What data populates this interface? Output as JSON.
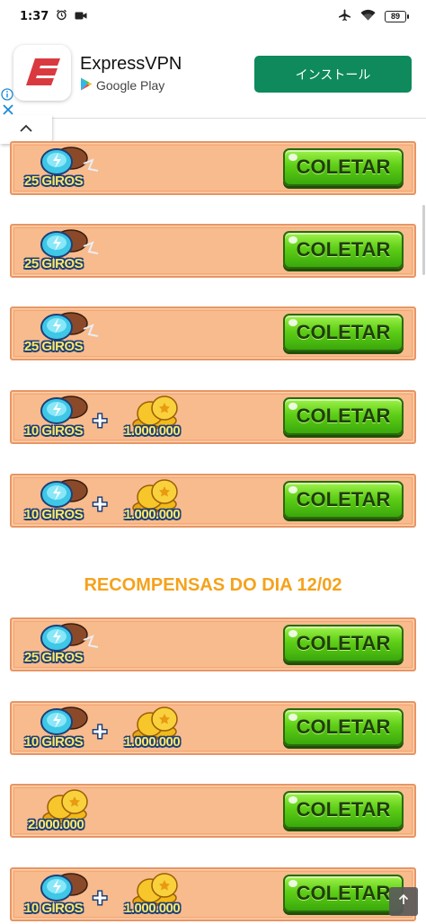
{
  "status_bar": {
    "time": "1:37",
    "battery": "89",
    "icons": [
      "alarm-icon",
      "video-record-icon",
      "airplane-mode-icon",
      "wifi-icon",
      "battery-icon"
    ]
  },
  "ad": {
    "app_name": "ExpressVPN",
    "store_name": "Google Play",
    "install_label": "インストール",
    "accent": "#0e8a5c",
    "logo_color": "#da3940"
  },
  "section_heading": "RECOMPENSAS DO DIA 12/02",
  "rewards": [
    {
      "type": "spins",
      "spins_label": "25 GIROS",
      "button_label": "COLETAR"
    },
    {
      "type": "spins",
      "spins_label": "25 GIROS",
      "button_label": "COLETAR"
    },
    {
      "type": "spins",
      "spins_label": "25 GIROS",
      "button_label": "COLETAR"
    },
    {
      "type": "spins_coins",
      "spins_label": "10 GIROS",
      "coins_label": "1.000.000",
      "button_label": "COLETAR"
    },
    {
      "type": "spins_coins",
      "spins_label": "10 GIROS",
      "coins_label": "1.000.000",
      "button_label": "COLETAR"
    },
    {
      "type": "spins",
      "spins_label": "25 GIROS",
      "button_label": "COLETAR"
    },
    {
      "type": "spins_coins",
      "spins_label": "10 GIROS",
      "coins_label": "1.000.000",
      "button_label": "COLETAR"
    },
    {
      "type": "coins",
      "coins_label": "2.000.000",
      "button_label": "COLETAR"
    },
    {
      "type": "spins_coins",
      "spins_label": "10 GIROS",
      "coins_label": "1.000.000",
      "button_label": "COLETAR"
    }
  ],
  "colors": {
    "row_fill": "#f8bb8d",
    "row_border": "#e89563",
    "button_green": "#5fcf17",
    "heading_orange": "#f5a21c",
    "label_yellow": "#fde86a",
    "label_outline": "#1d3f78"
  }
}
